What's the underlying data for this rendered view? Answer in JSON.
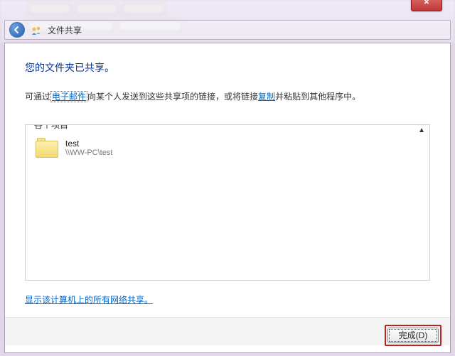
{
  "header": {
    "title": "文件共享"
  },
  "dialog": {
    "heading": "您的文件夹已共享。",
    "instruction_pre": "可通过",
    "instruction_link1": "电子邮件",
    "instruction_mid": "向某个人发送到这些共享项的链接，或将链接",
    "instruction_link2": "复制",
    "instruction_post": "并粘贴到其他程序中。"
  },
  "group": {
    "label": "各个项目",
    "toggle": "▲"
  },
  "items": [
    {
      "name": "test",
      "path": "\\\\WW-PC\\test"
    }
  ],
  "links": {
    "show_all_shares": "显示该计算机上的所有网络共享。"
  },
  "buttons": {
    "done": "完成(D)"
  }
}
